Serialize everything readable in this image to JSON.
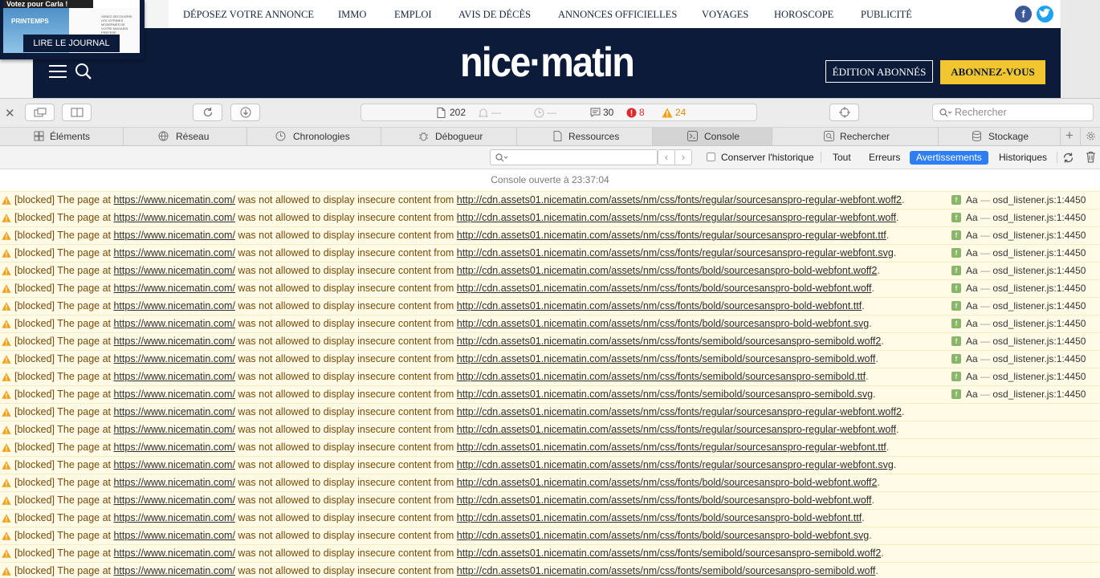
{
  "site": {
    "journal": {
      "thumb_text": "Votez pour Carla !",
      "promo_text": "PRINTEMPS",
      "promo_small": "VENEZ DECOUVRIR LES VITRINES MODERNES DE VOTRE MAGASIN PREFERE",
      "button": "LIRE LE JOURNAL"
    },
    "nav": [
      "DÉPOSEZ VOTRE ANNONCE",
      "IMMO",
      "EMPLOI",
      "AVIS DE DÉCÈS",
      "ANNONCES OFFICIELLES",
      "VOYAGES",
      "HOROSCOPE",
      "PUBLICITÉ"
    ],
    "social": {
      "facebook": "f",
      "twitter": "t"
    },
    "logo": "nice·matin",
    "btn_edition": "ÉDITION ABONNÉS",
    "btn_subscribe": "ABONNEZ-VOUS"
  },
  "inspector": {
    "toolbar": {
      "resources_count": "202",
      "dash1": "—",
      "dash2": "—",
      "messages_count": "30",
      "errors_count": "8",
      "warnings_count": "24",
      "search_placeholder": "Rechercher"
    },
    "tabs": [
      "Éléments",
      "Réseau",
      "Chronologies",
      "Débogueur",
      "Ressources",
      "Console",
      "Rechercher",
      "Stockage"
    ],
    "active_tab": "Console",
    "filter": {
      "preserve_label": "Conserver l'historique",
      "buttons": [
        "Tout",
        "Erreurs",
        "Avertissements",
        "Historiques"
      ],
      "active": "Avertissements"
    },
    "console_opened": "Console ouverte à 23:37:04",
    "message_prefix": "[blocked] The page at",
    "page_url": "https://www.nicematin.com/",
    "message_middle": "was not allowed to display insecure content from",
    "source_badge": "f",
    "source_aa": "Aa",
    "source_dash": "—",
    "source_location": "osd_listener.js:1:4450",
    "messages": [
      {
        "url": "http://cdn.assets01.nicematin.com/assets/nm/css/fonts/regular/sourcesanspro-regular-webfont.woff2",
        "source": true
      },
      {
        "url": "http://cdn.assets01.nicematin.com/assets/nm/css/fonts/regular/sourcesanspro-regular-webfont.woff",
        "source": true
      },
      {
        "url": "http://cdn.assets01.nicematin.com/assets/nm/css/fonts/regular/sourcesanspro-regular-webfont.ttf",
        "source": true
      },
      {
        "url": "http://cdn.assets01.nicematin.com/assets/nm/css/fonts/regular/sourcesanspro-regular-webfont.svg",
        "source": true
      },
      {
        "url": "http://cdn.assets01.nicematin.com/assets/nm/css/fonts/bold/sourcesanspro-bold-webfont.woff2",
        "source": true
      },
      {
        "url": "http://cdn.assets01.nicematin.com/assets/nm/css/fonts/bold/sourcesanspro-bold-webfont.woff",
        "source": true
      },
      {
        "url": "http://cdn.assets01.nicematin.com/assets/nm/css/fonts/bold/sourcesanspro-bold-webfont.ttf",
        "source": true
      },
      {
        "url": "http://cdn.assets01.nicematin.com/assets/nm/css/fonts/bold/sourcesanspro-bold-webfont.svg",
        "source": true
      },
      {
        "url": "http://cdn.assets01.nicematin.com/assets/nm/css/fonts/semibold/sourcesanspro-semibold.woff2",
        "source": true
      },
      {
        "url": "http://cdn.assets01.nicematin.com/assets/nm/css/fonts/semibold/sourcesanspro-semibold.woff",
        "source": true
      },
      {
        "url": "http://cdn.assets01.nicematin.com/assets/nm/css/fonts/semibold/sourcesanspro-semibold.ttf",
        "source": true
      },
      {
        "url": "http://cdn.assets01.nicematin.com/assets/nm/css/fonts/semibold/sourcesanspro-semibold.svg",
        "source": true
      },
      {
        "url": "http://cdn.assets01.nicematin.com/assets/nm/css/fonts/regular/sourcesanspro-regular-webfont.woff2",
        "source": false
      },
      {
        "url": "http://cdn.assets01.nicematin.com/assets/nm/css/fonts/regular/sourcesanspro-regular-webfont.woff",
        "source": false
      },
      {
        "url": "http://cdn.assets01.nicematin.com/assets/nm/css/fonts/regular/sourcesanspro-regular-webfont.ttf",
        "source": false
      },
      {
        "url": "http://cdn.assets01.nicematin.com/assets/nm/css/fonts/regular/sourcesanspro-regular-webfont.svg",
        "source": false
      },
      {
        "url": "http://cdn.assets01.nicematin.com/assets/nm/css/fonts/bold/sourcesanspro-bold-webfont.woff2",
        "source": false
      },
      {
        "url": "http://cdn.assets01.nicematin.com/assets/nm/css/fonts/bold/sourcesanspro-bold-webfont.woff",
        "source": false
      },
      {
        "url": "http://cdn.assets01.nicematin.com/assets/nm/css/fonts/bold/sourcesanspro-bold-webfont.ttf",
        "source": false
      },
      {
        "url": "http://cdn.assets01.nicematin.com/assets/nm/css/fonts/bold/sourcesanspro-bold-webfont.svg",
        "source": false
      },
      {
        "url": "http://cdn.assets01.nicematin.com/assets/nm/css/fonts/semibold/sourcesanspro-semibold.woff2",
        "source": false
      },
      {
        "url": "http://cdn.assets01.nicematin.com/assets/nm/css/fonts/semibold/sourcesanspro-semibold.woff",
        "source": false
      }
    ]
  },
  "colors": {
    "brand_navy": "#0d1b3a",
    "subscribe_yellow": "#f2c62f",
    "warning_bg": "#fffbe6",
    "warning_text": "#7a4a06",
    "active_filter": "#2d7ef4",
    "error_red": "#e0292d",
    "warning_orange": "#f0a21a"
  }
}
